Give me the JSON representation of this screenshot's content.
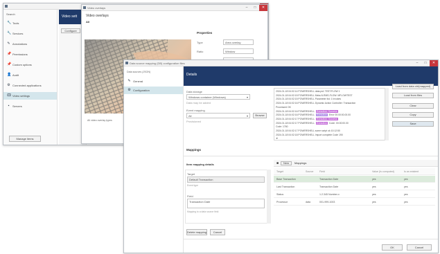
{
  "colors": {
    "navy_header": "#1f3a6a",
    "selection": "#d4e6ec",
    "close_button": "#c8373c",
    "log_highlight_purple": "#c36bd8",
    "log_highlight_violet": "#a987e6",
    "row_highlight": "#dcebdc"
  },
  "back_window": {
    "title": "",
    "header_title": "Search",
    "nav": [
      {
        "icon": "tools-icon",
        "glyph": "🔧",
        "label": "Tools"
      },
      {
        "icon": "wrench-icon",
        "glyph": "🔧",
        "label": "Services"
      },
      {
        "icon": "pencil-icon",
        "glyph": "✎",
        "label": "Annotations"
      },
      {
        "icon": "pin-icon",
        "glyph": "📌",
        "label": "Permissions"
      },
      {
        "icon": "pin-icon",
        "glyph": "📌",
        "label": "Custom options"
      },
      {
        "icon": "person-icon",
        "glyph": "👤",
        "label": "Audit"
      },
      {
        "icon": "settings-icon",
        "glyph": "⚙",
        "label": "Connected applications"
      },
      {
        "icon": "camera-icon",
        "glyph": "🎞",
        "label": "Video settings"
      },
      {
        "icon": "server-icon",
        "glyph": "▪",
        "label": "Servers"
      }
    ],
    "dark_panel_title": "Video sett",
    "panel_button": "Configure",
    "bottom_button": "Manage items"
  },
  "video_window": {
    "title": "Video overlays",
    "header": "Video overlays",
    "subheader": "All",
    "properties_title": "Properties",
    "properties": [
      {
        "key": "Type",
        "value": "Area overlay"
      },
      {
        "key": "Ratio",
        "value": "Window"
      },
      {
        "key": "Location",
        "value": "Auto"
      }
    ],
    "caption": "All video overlay types"
  },
  "front_window": {
    "title": "Data source mapping (DB) configuration files",
    "sidebar_caption": "Data sources (JSON)",
    "sidebar_items": [
      {
        "icon": "pencil-icon",
        "glyph": "✎",
        "label": "General"
      },
      {
        "icon": "gear-icon",
        "glyph": "⚙",
        "label": "Configuration",
        "active": true
      }
    ],
    "header": "Details",
    "data_source_label": "Data storage",
    "data_source_value": "Windows container (Windows)",
    "data_source_hint": "Data may be added",
    "event_type_label": "Event mapping",
    "event_type_value": "All",
    "event_type_hint": "Provisioned",
    "browse_button": "Browse",
    "log_lines": [
      {
        "text": "2024-01-18 04:02:14 POWERSHELL data.ps1 TEST:FLOW 1",
        "hl": null
      },
      {
        "text": "2024-01-18 04:02:15 POWERSHELL Meta-N-RMS-FLOW: MFLOWTEST",
        "hl": null
      },
      {
        "text": "2024-01-18 04:02:15 POWERSHELL Parameter list: 1 Invokes",
        "hl": null
      },
      {
        "text": "2024-01-18 04:02:16 POWERSHELL Dynamic Action Controller: Transaction",
        "hl": null
      },
      {
        "text": "Processed OK",
        "hl": null
      },
      {
        "text": "2024-01-18 04:02:16 POWERSHELL",
        "hl": "Execution: Success",
        "hlcolor": "#c36bd8"
      },
      {
        "text": "2024-01-18 04:02:16 POWERSHELL",
        "hl": "Execution",
        "hlcolor": "#a987e6",
        "tail": "Error 00:00:00.00.00"
      },
      {
        "text": "2024-01-18 04:02:17 POWERSHELL",
        "hl": "Execution: Success",
        "hlcolor": "#c36bd8"
      },
      {
        "text": "2024-01-18 04:02:17 POWERSHELL",
        "hl": "Execution",
        "hlcolor": "#c36bd8",
        "tail": "Code: 00:00:00.00"
      },
      {
        "text": "Code: 1760",
        "hl": null
      },
      {
        "text": "2024-01-18 04:02:17 POWERSHELL some script ok 10:12:50",
        "hl": null
      },
      {
        "text": "2024-01-18 04:02:18 POWERSHELL Import complete Code 190",
        "hl": null
      },
      {
        "text": "▼",
        "hl": null
      }
    ],
    "right_buttons": [
      "Load from data ctrl(mapped)",
      "Load from files",
      "Clear",
      "Copy",
      "Save"
    ],
    "mappings_title": "Mappings",
    "mapping_details_title": "Item mapping details",
    "mapping_detail_fields": [
      {
        "label": "Target",
        "value": "Default Transaction",
        "hint": "Event type"
      },
      {
        "label": "Field",
        "value": "Transaction Date",
        "hint": "Mapping to a data source field"
      }
    ],
    "add_mapping_button": "Delete mapping",
    "remove_button": "Cancel",
    "toolbar_new": "New",
    "toolbar_label": "Mappings",
    "table_columns": [
      "Target",
      "Source",
      "Field",
      "Value (Is computed)",
      "Is an existent"
    ],
    "table_rows": [
      {
        "cells": [
          "Base Transaction",
          "",
          "Transaction Date",
          "yes",
          "yes"
        ],
        "selected": true
      },
      {
        "cells": [
          "Last Transaction",
          "",
          "Transaction Date",
          "yes",
          "yes"
        ]
      },
      {
        "cells": [
          "Status",
          "",
          "1.2.345 Number-x",
          "yes",
          "yes"
        ]
      },
      {
        "cells": [
          "Processor",
          "data",
          "001-999-1003",
          "yes",
          "yes"
        ]
      }
    ],
    "ok_button": "OK",
    "cancel_button": "Cancel"
  }
}
